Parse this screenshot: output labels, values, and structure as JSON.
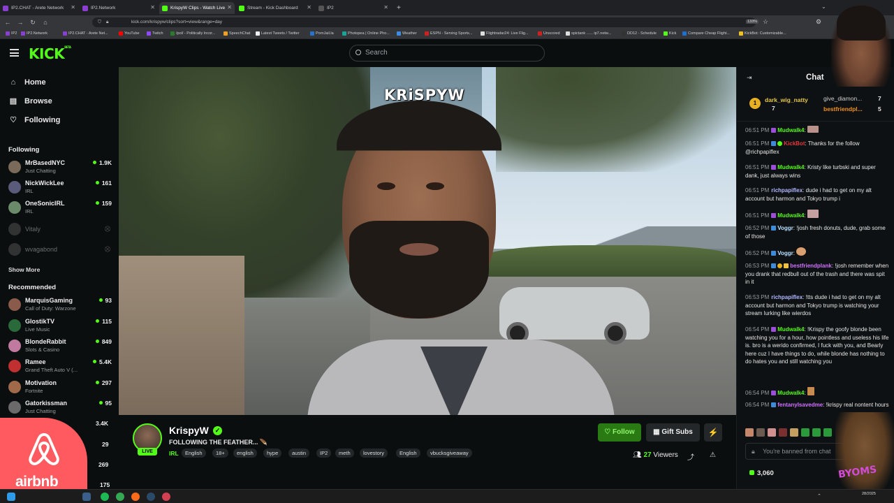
{
  "browser": {
    "tabs": [
      {
        "label": "IP2.CHAT - Arete Network",
        "color": "#8b3fd0"
      },
      {
        "label": "IP2.Network",
        "color": "#8b3fd0"
      },
      {
        "label": "KrispyW Clips - Watch Live",
        "color": "#53fc18",
        "active": true
      },
      {
        "label": "Stream - Kick Dashboard",
        "color": "#53fc18"
      },
      {
        "label": "IP2",
        "color": "#555"
      }
    ],
    "new_tab": "+",
    "url": "kick.com/krispyw/clips?sort=view&range=day",
    "zoom": "133%",
    "bookmarks": [
      {
        "label": "IP2",
        "color": "#8b3fd0"
      },
      {
        "label": "IP2.Network",
        "color": "#8b3fd0"
      },
      {
        "label": "IP2.CHAT - Arete Net...",
        "color": "#8b3fd0"
      },
      {
        "label": "YouTube",
        "color": "#ff0000"
      },
      {
        "label": "Twitch",
        "color": "#9146ff"
      },
      {
        "label": "/pol/ - Politically Incor...",
        "color": "#2c7a2c"
      },
      {
        "label": "SpeechChat",
        "color": "#f0a020"
      },
      {
        "label": "Latest Tweets / Twitter",
        "color": "#eeeeee"
      },
      {
        "label": "PornJail.la",
        "color": "#2a72c9"
      },
      {
        "label": "Photopea | Online Pho...",
        "color": "#18a497"
      },
      {
        "label": "Weather",
        "color": "#3a8de0"
      },
      {
        "label": "ESPN - Serving Sports...",
        "color": "#d02020"
      },
      {
        "label": "Flightradar24: Live Flig...",
        "color": "#ddd"
      },
      {
        "label": "Unscored",
        "color": "#d02020"
      },
      {
        "label": "spictank ...... ip7.netw...",
        "color": "#ddd"
      },
      {
        "label": "DD12 - Schedule",
        "color": "#333"
      },
      {
        "label": "Kick",
        "color": "#53fc18"
      },
      {
        "label": "Compare Cheap Flight...",
        "color": "#1f6fd0"
      },
      {
        "label": "KickBot: Customizable...",
        "color": "#f0c020"
      }
    ]
  },
  "header": {
    "logo": "KICK",
    "logo_sup": "BETA",
    "search_placeholder": "Search"
  },
  "sidebar": {
    "nav": [
      {
        "label": "Home",
        "icon": "home-icon",
        "glyph": "⌂"
      },
      {
        "label": "Browse",
        "icon": "browse-icon",
        "glyph": "▤"
      },
      {
        "label": "Following",
        "icon": "heart-icon",
        "glyph": "♡"
      }
    ],
    "following_heading": "Following",
    "following": [
      {
        "name": "MrBasedNYC",
        "category": "Just Chatting",
        "viewers": "1.9K",
        "color": "#7a6a5a"
      },
      {
        "name": "NickWickLee",
        "category": "IRL",
        "viewers": "161",
        "color": "#5a5a7a"
      },
      {
        "name": "OneSonicIRL",
        "category": "IRL",
        "viewers": "159",
        "color": "#6a8a6a"
      },
      {
        "name": "Vitaly",
        "offline": true,
        "color": "#777"
      },
      {
        "name": "wvagabond",
        "offline": true,
        "color": "#777"
      }
    ],
    "show_more": "Show More",
    "recommended_heading": "Recommended",
    "recommended": [
      {
        "name": "MarquisGaming",
        "category": "Call of Duty: Warzone",
        "viewers": "93",
        "color": "#8a5a4a"
      },
      {
        "name": "GlostikTV",
        "category": "Live Music",
        "viewers": "115",
        "color": "#2a6a3a"
      },
      {
        "name": "BlondeRabbit",
        "category": "Slots & Casino",
        "viewers": "849",
        "color": "#c07aa0"
      },
      {
        "name": "Ramee",
        "category": "Grand Theft Auto V (...",
        "viewers": "5.4K",
        "color": "#c03030"
      },
      {
        "name": "Motivation",
        "category": "Fortnite",
        "viewers": "297",
        "color": "#a06a4a"
      },
      {
        "name": "Gatorkissman",
        "category": "Just Chatting",
        "viewers": "95",
        "color": "#6a6a6a"
      }
    ],
    "hidden_viewers": [
      "3.4K",
      "29",
      "269",
      "175"
    ]
  },
  "overlay": {
    "airbnb_text": "airbnb",
    "airbnb_color": "#ff5a5f"
  },
  "video": {
    "watermark": "KRiSPYW"
  },
  "stream_info": {
    "channel_name": "KrispyW",
    "live_badge": "LIVE",
    "title": "FOLLOWING THE FEATHER...",
    "title_emoji": "🪶",
    "category": "IRL",
    "tags": [
      "English",
      "18+",
      "english",
      "hype",
      "austin",
      "IP2",
      "meth",
      "lovestory",
      "English",
      "vbucksgiveaway"
    ],
    "follow_label": "Follow",
    "gift_label": "Gift Subs",
    "viewers_count": "27",
    "viewers_label": "Viewers"
  },
  "chat": {
    "title": "Chat",
    "top_gifters": [
      {
        "rank": "1",
        "name": "dark_wig_natty",
        "count": "7"
      },
      {
        "name": "give_diamon...",
        "count": "7"
      },
      {
        "name": "bestfriendpl...",
        "count": "5"
      }
    ],
    "messages": [
      {
        "time": "06:51 PM",
        "user": "Mudwalk4",
        "color": "#53fc18",
        "text": ""
      },
      {
        "time": "06:51 PM",
        "user": "KickBot",
        "color": "#e0393e",
        "text": "Thanks for the follow @richpapiflex"
      },
      {
        "time": "06:51 PM",
        "user": "Mudwalk4",
        "color": "#53fc18",
        "text": "Kristy like turbski and super dank, just always wins"
      },
      {
        "time": "06:51 PM",
        "user": "richpapiflex",
        "color": "#b0b8ff",
        "text": "dude i had to get on my alt account but harmon and Tokyo trump i"
      },
      {
        "time": "06:51 PM",
        "user": "Mudwalk4",
        "color": "#53fc18",
        "text": ""
      },
      {
        "time": "06:52 PM",
        "user": "Voggr",
        "color": "#b8e0ff",
        "text": "!josh fresh donuts, dude, grab some of those"
      },
      {
        "time": "06:52 PM",
        "user": "Voggr",
        "color": "#b8e0ff",
        "text": ""
      },
      {
        "time": "06:53 PM",
        "user": "bestfriendplank",
        "color": "#d070ff",
        "text": "!josh remember when you drank that redbull out of the trash and there was spit in it"
      },
      {
        "time": "06:53 PM",
        "user": "richpapiflex",
        "color": "#b0b8ff",
        "text": "!tts dude i had to get on my alt account but harmon and Tokyo trump is watching your stream lurking like wierdos"
      },
      {
        "time": "06:54 PM",
        "user": "Mudwalk4",
        "color": "#53fc18",
        "text": "!Krispy the goofy blonde been watching you for a hour, how pointless and useless his life is. bro is a werido confirmed, I fuck with you, and Bearly here cuz I have things to do, while blonde has nothing to do hates you and still watching you"
      },
      {
        "time": "06:54 PM",
        "user": "Mudwalk4",
        "color": "#53fc18",
        "text": ""
      },
      {
        "time": "06:54 PM",
        "user": "fentanylsavedme",
        "color": "#d070ff",
        "text": "!krispy real nontent hours"
      }
    ],
    "input_placeholder": "You're banned from chat",
    "points": "3,060"
  },
  "webcam": {
    "overlay_text": "BYOMS"
  },
  "taskbar": {
    "date": "28/2025"
  }
}
